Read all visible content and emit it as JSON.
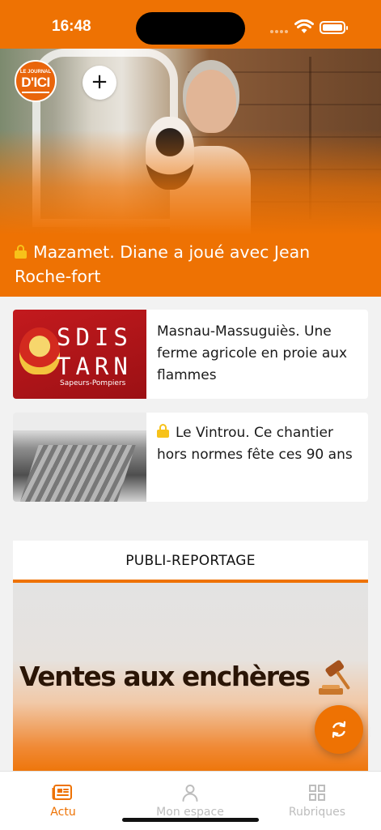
{
  "status_bar": {
    "time": "16:48"
  },
  "header": {
    "logo_top": "LE JOURNAL",
    "logo_main": "D'ICI",
    "add_label": "+"
  },
  "hero": {
    "title": "Mazamet. Diane a joué avec Jean Roche-fort",
    "locked": true
  },
  "articles": [
    {
      "title": "Masnau-Massuguiès. Une ferme agricole en proie aux flammes",
      "locked": false,
      "thumb_lines": [
        "SDIS",
        "TARN"
      ],
      "thumb_sub": "Sapeurs-Pompiers"
    },
    {
      "title": "Le Vintrou. Ce chantier hors normes fête ces 90 ans",
      "locked": true
    }
  ],
  "publi": {
    "header": "PUBLI-REPORTAGE",
    "title": "Ventes aux enchères"
  },
  "bottom_nav": {
    "items": [
      {
        "label": "Actu",
        "icon": "newspaper-icon",
        "active": true
      },
      {
        "label": "Mon espace",
        "icon": "user-icon",
        "active": false
      },
      {
        "label": "Rubriques",
        "icon": "grid-icon",
        "active": false
      }
    ]
  },
  "colors": {
    "accent": "#ee7203",
    "lock": "#f7c21a",
    "inactive": "#bdbdbd"
  }
}
